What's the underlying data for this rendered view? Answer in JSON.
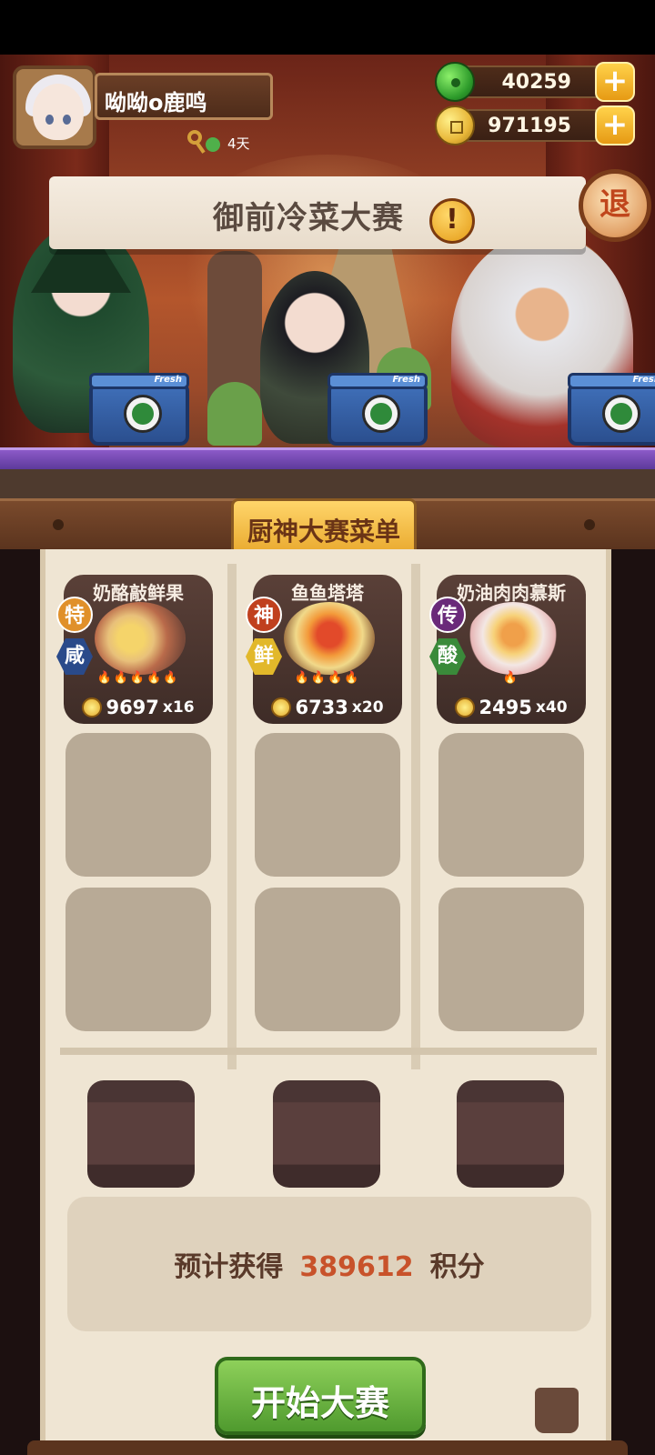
{
  "player": {
    "name": "呦呦o鹿鸣",
    "key_days": "4天"
  },
  "currency": {
    "jade": "40259",
    "gold": "971195"
  },
  "event": {
    "title": "御前冷菜大赛",
    "exit_label": "退",
    "alert_label": "!"
  },
  "menu": {
    "title": "厨神大赛菜单",
    "dishes": [
      {
        "name": "奶酪敲鲜果",
        "grade": "特",
        "flavor": "咸",
        "grade_color": "#e0902a",
        "flavor_color": "#2a4a8a",
        "price": "9697",
        "qty": "x16",
        "flames": "🔥🔥🔥🔥🔥"
      },
      {
        "name": "鱼鱼塔塔",
        "grade": "神",
        "flavor": "鲜",
        "grade_color": "#c0401e",
        "flavor_color": "#e2b82a",
        "price": "6733",
        "qty": "x20",
        "flames": "🔥🔥🔥🔥"
      },
      {
        "name": "奶油肉肉慕斯",
        "grade": "传",
        "flavor": "酸",
        "grade_color": "#6a2a7a",
        "flavor_color": "#3a8a3a",
        "price": "2495",
        "qty": "x40",
        "flames": "🔥"
      }
    ]
  },
  "score": {
    "label": "预计获得",
    "value": "389612",
    "unit": "积分"
  },
  "start_button": "开始大赛",
  "cooler_label": "Fresh"
}
